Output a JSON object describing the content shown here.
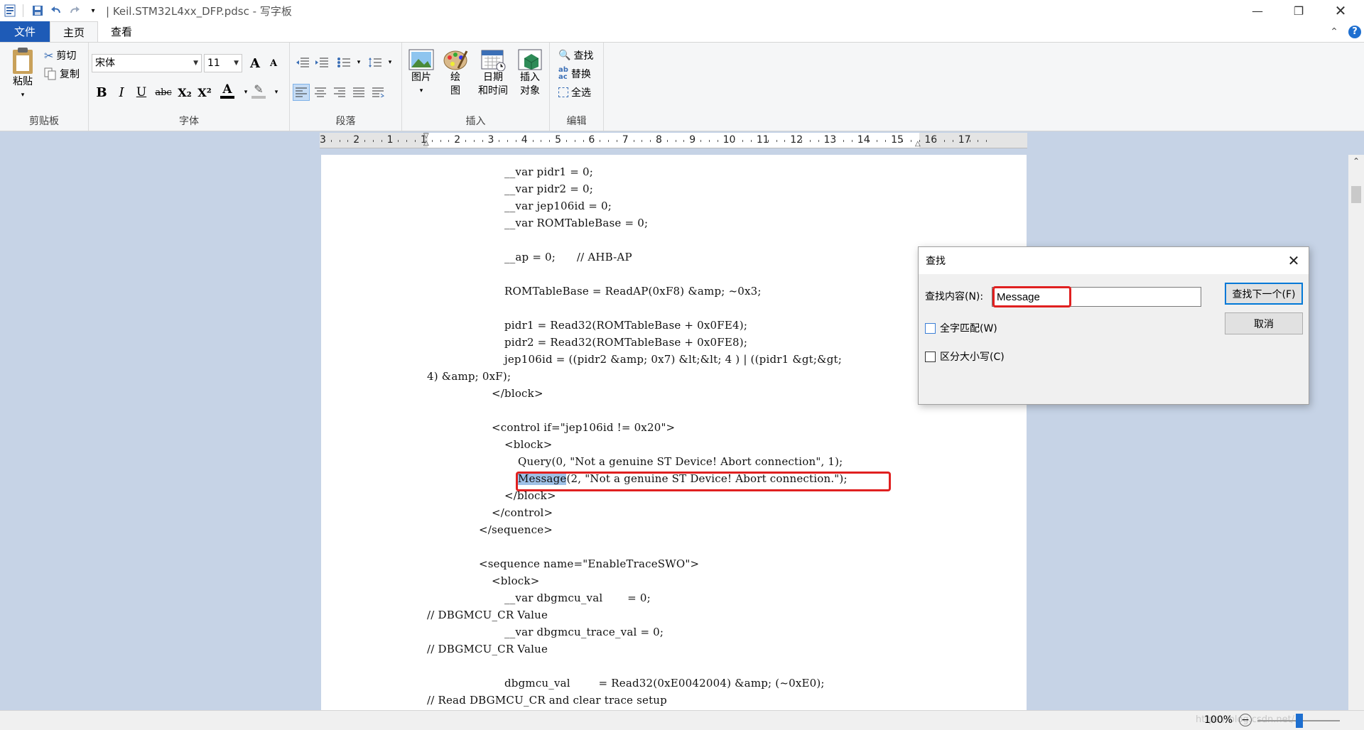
{
  "window": {
    "title": "| Keil.STM32L4xx_DFP.pdsc - 写字板"
  },
  "tabs": [
    {
      "label": "文件"
    },
    {
      "label": "主页"
    },
    {
      "label": "查看"
    }
  ],
  "ribbon": {
    "clipboard": {
      "label": "剪贴板",
      "paste": "粘贴",
      "cut": "剪切",
      "copy": "复制"
    },
    "font": {
      "label": "字体",
      "family": "宋体",
      "size": "11",
      "bold": "B",
      "italic": "I",
      "underline": "U",
      "strike": "abc",
      "subscript": "X₂",
      "superscript": "X²",
      "grow": "A",
      "shrink": "A",
      "color": "A"
    },
    "paragraph": {
      "label": "段落"
    },
    "insert": {
      "label": "插入",
      "picture": "图片",
      "paint_l1": "绘",
      "paint_l2": "图",
      "datetime_l1": "日期",
      "datetime_l2": "和时间",
      "object_l1": "插入",
      "object_l2": "对象"
    },
    "edit": {
      "label": "编辑",
      "find": "查找",
      "replace": "替换",
      "select_all": "全选"
    }
  },
  "ruler": {
    "labels": [
      "3",
      "2",
      "1",
      "1",
      "2",
      "3",
      "4",
      "5",
      "6",
      "7",
      "8",
      "9",
      "10",
      "11",
      "12",
      "13",
      "14",
      "15",
      "16",
      "17"
    ]
  },
  "document": {
    "lines": [
      "__var pidr1 = 0;",
      "__var pidr2 = 0;",
      "__var jep106id = 0;",
      "__var ROMTableBase = 0;",
      "__ap = 0;      // AHB-AP",
      "ROMTableBase = ReadAP(0xF8) &amp; ~0x3;",
      "pidr1 = Read32(ROMTableBase + 0x0FE4);",
      "pidr2 = Read32(ROMTableBase + 0x0FE8);",
      "jep106id = ((pidr2 &amp; 0x7) &lt;&lt; 4 ) | ((pidr1 &gt;&gt;",
      "4) &amp; 0xF);",
      "</block>",
      "<control if=\"jep106id != 0x20\">",
      "<block>",
      "Query(0, \"Not a genuine ST Device! Abort connection\", 1);",
      "Message",
      "(2, \"Not a genuine ST Device! Abort connection.\");",
      "</block>",
      "</control>",
      "</sequence>",
      "<sequence name=\"EnableTraceSWO\">",
      "<block>",
      "__var dbgmcu_val       = 0;",
      "// DBGMCU_CR Value",
      "__var dbgmcu_trace_val = 0;",
      "// DBGMCU_CR Value",
      "dbgmcu_val        = Read32(0xE0042004) &amp; (~0xE0);",
      "// Read DBGMCU_CR and clear trace setup"
    ]
  },
  "find_dialog": {
    "title": "查找",
    "label": "查找内容(N):",
    "value": "Message",
    "find_next": "查找下一个(F)",
    "cancel": "取消",
    "whole_word": "全字匹配(W)",
    "match_case": "区分大小写(C)"
  },
  "status": {
    "zoom": "100%",
    "watermark": "https://blog.csdn.net/..."
  }
}
